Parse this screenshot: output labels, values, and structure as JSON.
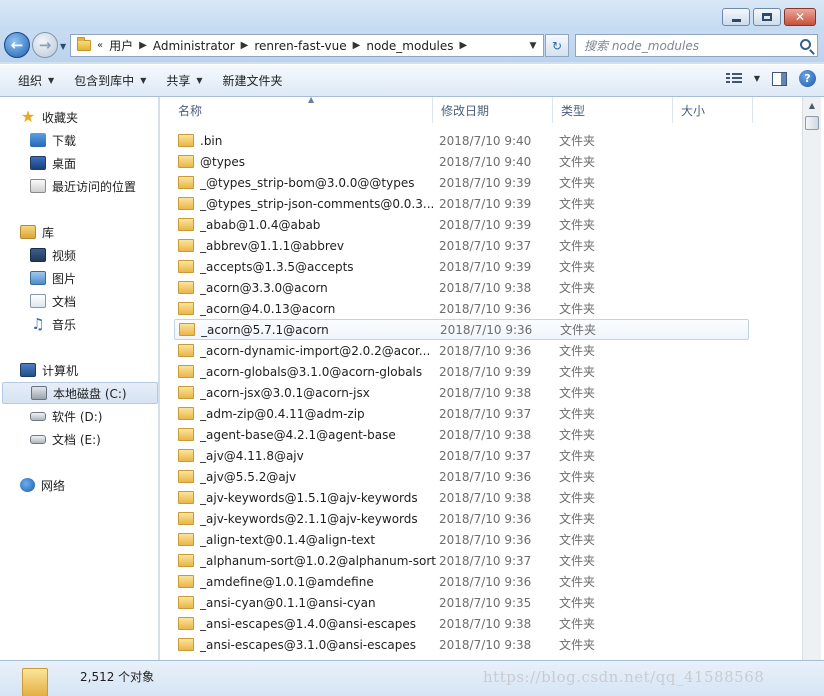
{
  "window": {
    "controls": {
      "minimize": "",
      "maximize": "",
      "close": "✕"
    }
  },
  "address": {
    "overflow": "«",
    "crumbs": [
      "用户",
      "Administrator",
      "renren-fast-vue",
      "node_modules"
    ],
    "search_placeholder": "搜索 node_modules"
  },
  "toolbar": {
    "organize": "组织",
    "include_in_library": "包含到库中",
    "share": "共享",
    "new_folder": "新建文件夹"
  },
  "sidebar": {
    "favorites": {
      "label": "收藏夹",
      "items": [
        "下载",
        "桌面",
        "最近访问的位置"
      ]
    },
    "libraries": {
      "label": "库",
      "items": [
        "视频",
        "图片",
        "文档",
        "音乐"
      ]
    },
    "computer": {
      "label": "计算机",
      "items": [
        "本地磁盘 (C:)",
        "软件 (D:)",
        "文档 (E:)"
      ]
    },
    "network": {
      "label": "网络"
    }
  },
  "columns": {
    "name": "名称",
    "date": "修改日期",
    "type": "类型",
    "size": "大小"
  },
  "files": [
    {
      "name": ".bin",
      "date": "2018/7/10 9:40",
      "type": "文件夹"
    },
    {
      "name": "@types",
      "date": "2018/7/10 9:40",
      "type": "文件夹"
    },
    {
      "name": "_@types_strip-bom@3.0.0@@types",
      "date": "2018/7/10 9:39",
      "type": "文件夹"
    },
    {
      "name": "_@types_strip-json-comments@0.0.3...",
      "date": "2018/7/10 9:39",
      "type": "文件夹"
    },
    {
      "name": "_abab@1.0.4@abab",
      "date": "2018/7/10 9:39",
      "type": "文件夹"
    },
    {
      "name": "_abbrev@1.1.1@abbrev",
      "date": "2018/7/10 9:37",
      "type": "文件夹"
    },
    {
      "name": "_accepts@1.3.5@accepts",
      "date": "2018/7/10 9:39",
      "type": "文件夹"
    },
    {
      "name": "_acorn@3.3.0@acorn",
      "date": "2018/7/10 9:38",
      "type": "文件夹"
    },
    {
      "name": "_acorn@4.0.13@acorn",
      "date": "2018/7/10 9:36",
      "type": "文件夹"
    },
    {
      "name": "_acorn@5.7.1@acorn",
      "date": "2018/7/10 9:36",
      "type": "文件夹"
    },
    {
      "name": "_acorn-dynamic-import@2.0.2@acor...",
      "date": "2018/7/10 9:36",
      "type": "文件夹"
    },
    {
      "name": "_acorn-globals@3.1.0@acorn-globals",
      "date": "2018/7/10 9:39",
      "type": "文件夹"
    },
    {
      "name": "_acorn-jsx@3.0.1@acorn-jsx",
      "date": "2018/7/10 9:38",
      "type": "文件夹"
    },
    {
      "name": "_adm-zip@0.4.11@adm-zip",
      "date": "2018/7/10 9:37",
      "type": "文件夹"
    },
    {
      "name": "_agent-base@4.2.1@agent-base",
      "date": "2018/7/10 9:38",
      "type": "文件夹"
    },
    {
      "name": "_ajv@4.11.8@ajv",
      "date": "2018/7/10 9:37",
      "type": "文件夹"
    },
    {
      "name": "_ajv@5.5.2@ajv",
      "date": "2018/7/10 9:36",
      "type": "文件夹"
    },
    {
      "name": "_ajv-keywords@1.5.1@ajv-keywords",
      "date": "2018/7/10 9:38",
      "type": "文件夹"
    },
    {
      "name": "_ajv-keywords@2.1.1@ajv-keywords",
      "date": "2018/7/10 9:36",
      "type": "文件夹"
    },
    {
      "name": "_align-text@0.1.4@align-text",
      "date": "2018/7/10 9:36",
      "type": "文件夹"
    },
    {
      "name": "_alphanum-sort@1.0.2@alphanum-sort",
      "date": "2018/7/10 9:37",
      "type": "文件夹"
    },
    {
      "name": "_amdefine@1.0.1@amdefine",
      "date": "2018/7/10 9:36",
      "type": "文件夹"
    },
    {
      "name": "_ansi-cyan@0.1.1@ansi-cyan",
      "date": "2018/7/10 9:35",
      "type": "文件夹"
    },
    {
      "name": "_ansi-escapes@1.4.0@ansi-escapes",
      "date": "2018/7/10 9:38",
      "type": "文件夹"
    },
    {
      "name": "_ansi-escapes@3.1.0@ansi-escapes",
      "date": "2018/7/10 9:38",
      "type": "文件夹"
    }
  ],
  "hover_row": 9,
  "status": {
    "count": "2,512 个对象"
  },
  "watermark": "https://blog.csdn.net/qq_41588568"
}
